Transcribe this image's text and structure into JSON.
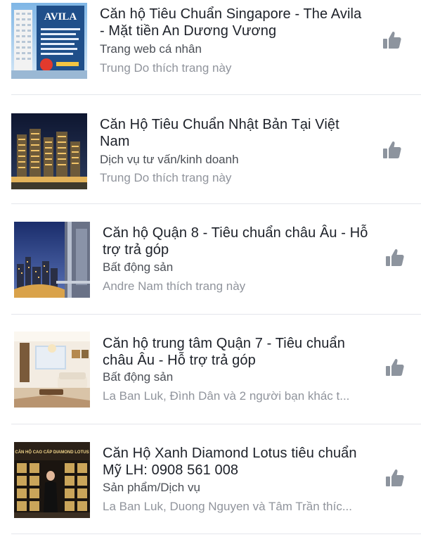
{
  "colors": {
    "title": "#1d2129",
    "category": "#4b4f56",
    "social": "#90949c",
    "like_icon": "#8d949e",
    "divider": "#e4e6eb"
  },
  "items": [
    {
      "title": "Căn hộ Tiêu Chuẩn Singapore - The Avila - Mặt tiền An Dương Vương",
      "category": "Trang web cá nhân",
      "social": "Trung Do thích trang này",
      "thumb_text": "AVILA",
      "icon": "thumbs-up-icon"
    },
    {
      "title": "Căn Hộ Tiêu Chuẩn Nhật Bản Tại Việt Nam",
      "category": "Dịch vụ tư vấn/kinh doanh",
      "social": "Trung Do thích trang này",
      "icon": "thumbs-up-icon"
    },
    {
      "title": "Căn hộ Quận 8 - Tiêu chuẩn châu Âu - Hỗ trợ trả góp",
      "category": "Bất động sản",
      "social": "Andre Nam thích trang này",
      "icon": "thumbs-up-icon"
    },
    {
      "title": "Căn hộ trung tâm Quận 7 - Tiêu chuẩn châu Âu - Hỗ trợ trả góp",
      "category": "Bất động sản",
      "social": "La Ban Luk, Đình Dân và 2 người bạn khác t...",
      "icon": "thumbs-up-icon"
    },
    {
      "title": "Căn Hộ Xanh Diamond Lotus tiêu chuẩn Mỹ LH: 0908 561 008",
      "category": "Sản phẩm/Dịch vụ",
      "social": "La Ban Luk, Duong Nguyen và Tâm Trần thíc...",
      "thumb_text": "CĂN HỘ CAO CẤP DIAMOND LOTUS",
      "icon": "thumbs-up-icon"
    }
  ]
}
